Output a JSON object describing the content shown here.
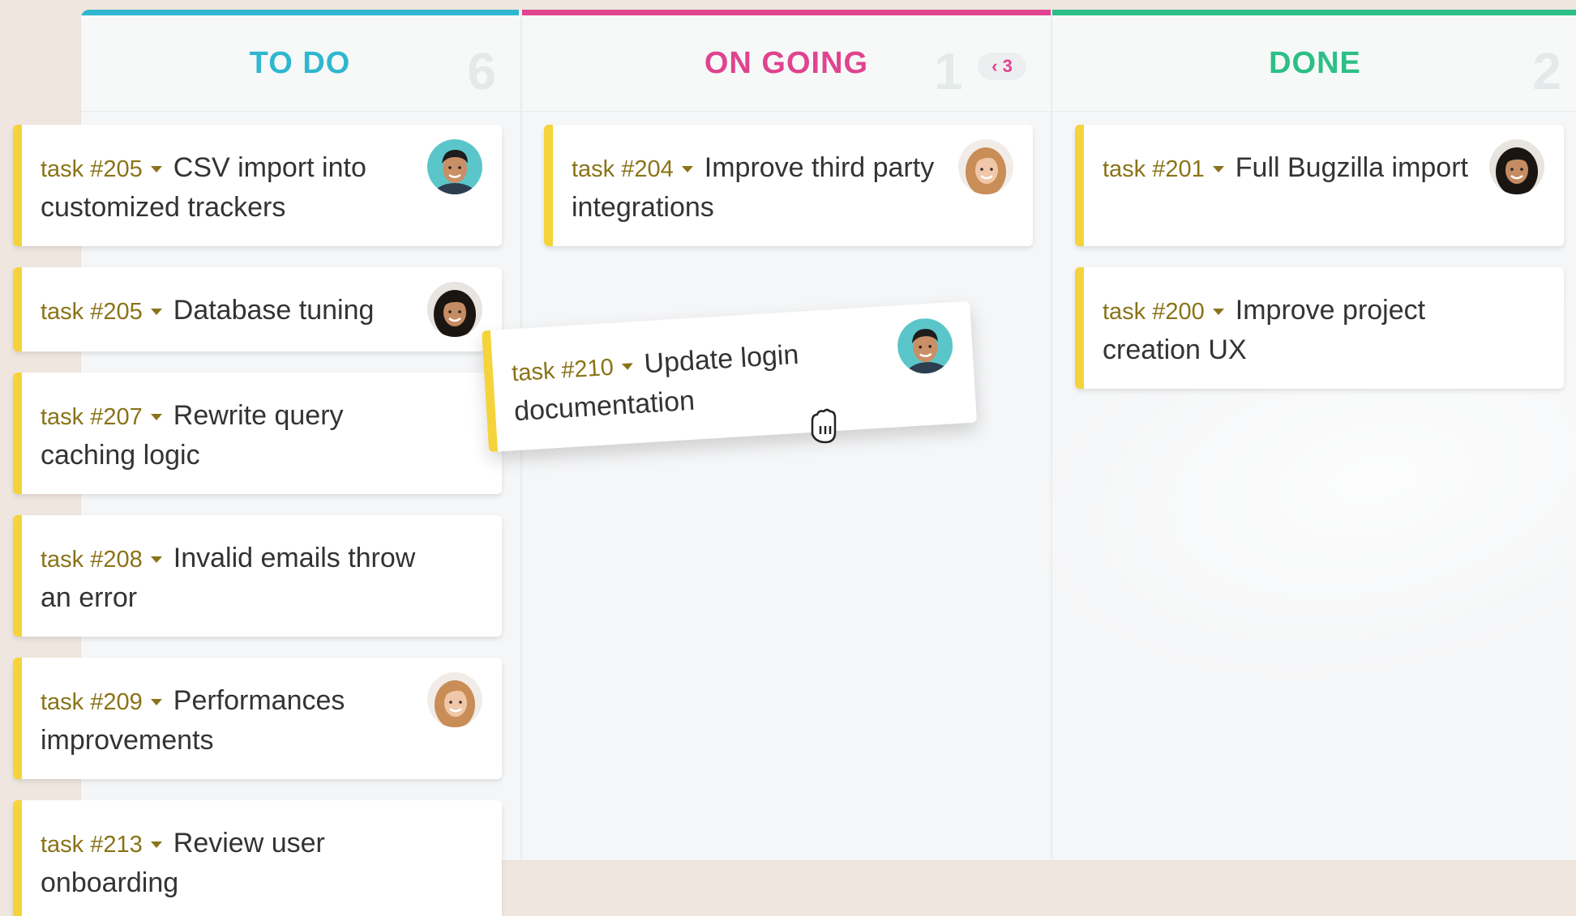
{
  "colors": {
    "background": "#efe7df",
    "todo_accent": "#2fb7cf",
    "ongoing_accent": "#e0438f",
    "done_accent": "#2cbf86",
    "card_stripe": "#f5d33b",
    "task_id": "#8a7318"
  },
  "columns": {
    "todo": {
      "title": "TO DO",
      "count": "6"
    },
    "ongoing": {
      "title": "ON GOING",
      "count": "1",
      "wip_limit": "‹ 3"
    },
    "done": {
      "title": "DONE",
      "count": "2"
    }
  },
  "cards": {
    "todo": [
      {
        "id": "task #205",
        "title": "CSV import into customized trackers",
        "avatar": "man-teal-avatar"
      },
      {
        "id": "task #205",
        "title": "Database tuning",
        "avatar": "woman-dark-hair-avatar"
      },
      {
        "id": "task #207",
        "title": "Rewrite query caching logic",
        "avatar": ""
      },
      {
        "id": "task #208",
        "title": "Invalid emails throw an error",
        "avatar": ""
      },
      {
        "id": "task #209",
        "title": "Performances improvements",
        "avatar": "woman-blonde-avatar"
      },
      {
        "id": "task #213",
        "title": "Review user onboarding",
        "avatar": ""
      }
    ],
    "ongoing": [
      {
        "id": "task #204",
        "title": "Improve third party integrations",
        "avatar": "woman-blonde-avatar"
      }
    ],
    "dragging": {
      "id": "task #210",
      "title": "Update login documentation",
      "avatar": "man-teal-avatar"
    },
    "done": [
      {
        "id": "task #201",
        "title": "Full Bugzilla import",
        "avatar": "woman-dark-hair-avatar"
      },
      {
        "id": "task #200",
        "title": "Improve project creation UX",
        "avatar": ""
      }
    ]
  },
  "icons": {
    "caret": "caret-down-icon",
    "cursor": "grab-hand-cursor-icon"
  }
}
